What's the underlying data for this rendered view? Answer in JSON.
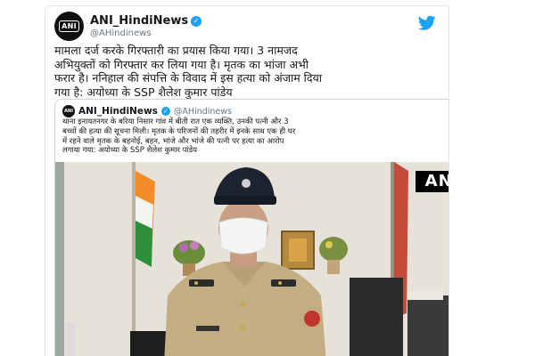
{
  "tweet": {
    "avatar_text": "ANI",
    "display_name": "ANI_HindiNews",
    "handle": "@AHindinews",
    "text": "मामला दर्ज करके गिरफ्तारी का प्रयास किया गया। 3 नामजद\nअभियुक्तों को गिरफ्तार कर लिया गया है। मृतक का भांजा अभी\nफरार है। ननिहाल की संपत्ति के विवाद में इस हत्या को अंजाम दिया\nगया है: अयोध्या के SSP शैलेश कुमार पांडेय",
    "icons": {
      "verified": "verified-badge-icon",
      "brand": "twitter-bird-icon"
    }
  },
  "quoted_tweet": {
    "avatar_text": "ANI",
    "display_name": "ANI_HindiNews",
    "handle": "@AHindinews",
    "text": "थाना इनायतनगर के बरिया निसार गांव में बीती रात एक व्यक्ति, उनकी पत्नी और 3\nबच्चों की हत्या की सूचना मिली। मृतक के परिजनों की तहरीर में इनके साथ एक ही घर\nमें रहने वाले मृतक के बहनोई, बहन, भांजे और भांजे की पत्नी पर हत्या का आरोप\nलगाया गया: अयोध्या के SSP शैलेश कुमार पांडेय",
    "media": {
      "watermark": "ANI",
      "description_icon": "video-frame-police-officer"
    }
  },
  "colors": {
    "twitter_blue": "#1da1f2",
    "text": "#14171a",
    "secondary": "#657786",
    "border": "#ccd6dd"
  }
}
